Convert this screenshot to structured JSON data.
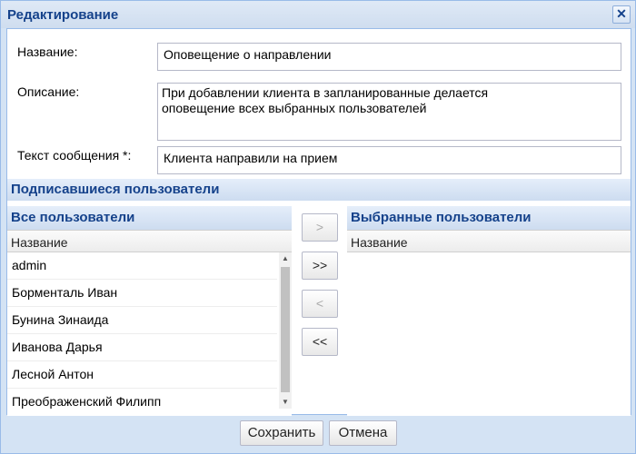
{
  "window": {
    "title": "Редактирование",
    "close_glyph": "✕"
  },
  "form": {
    "name_label": "Название:",
    "name_value": "Оповещение о направлении",
    "description_label": "Описание:",
    "description_value": "При добавлении клиента в запланированные делается\nоповещение всех выбранных пользователей",
    "message_label": "Текст сообщения *:",
    "message_value": "Клиента направили на прием"
  },
  "subscribers": {
    "section_title": "Подписавшиеся пользователи",
    "all_users": {
      "title": "Все пользователи",
      "column": "Название",
      "rows": [
        "admin",
        "Борменталь Иван",
        "Бунина Зинаида",
        "Иванова Дарья",
        "Лесной Антон",
        "Преображенский Филипп"
      ]
    },
    "selected_users": {
      "title": "Выбранные пользователи",
      "column": "Название",
      "rows": []
    },
    "buttons": {
      "add": ">",
      "add_all": ">>",
      "remove": "<",
      "remove_all": "<<"
    }
  },
  "footer": {
    "save": "Сохранить",
    "cancel": "Отмена"
  },
  "colors": {
    "title_text": "#15428b",
    "window_bg": "#d4e3f4",
    "border": "#99bbe8"
  },
  "icons": {
    "close": "close-icon",
    "scroll_up": "scroll-up-arrow-icon",
    "scroll_down": "scroll-down-arrow-icon"
  }
}
